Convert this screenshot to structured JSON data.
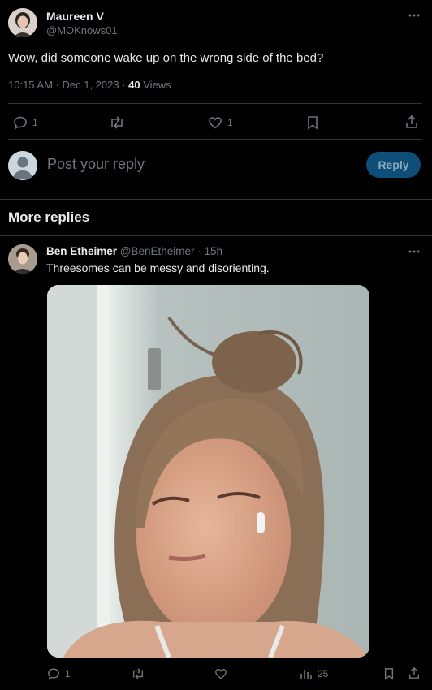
{
  "tweet": {
    "author_name": "Maureen V",
    "author_handle": "@MOKnows01",
    "text": "Wow, did someone wake up on the wrong side of the bed?",
    "time": "10:15 AM · Dec 1, 2023 · ",
    "views_count": "40",
    "views_label": " Views",
    "reply_count": "1",
    "like_count": "1"
  },
  "composer": {
    "placeholder": "Post your reply",
    "reply_button": "Reply"
  },
  "more_replies": {
    "heading": "More replies"
  },
  "reply": {
    "author_name": "Ben Etheimer",
    "author_handle": "@BenEtheimer",
    "time": " · 15h",
    "text": "Threesomes can be messy and disorienting.",
    "reply_count": "1",
    "views_count": "25"
  },
  "colors": {
    "accent": "#1d9bf0",
    "reply_button_bg": "#0f4e78",
    "background": "#000000",
    "divider": "#2f3336",
    "muted_text": "#71767b"
  }
}
